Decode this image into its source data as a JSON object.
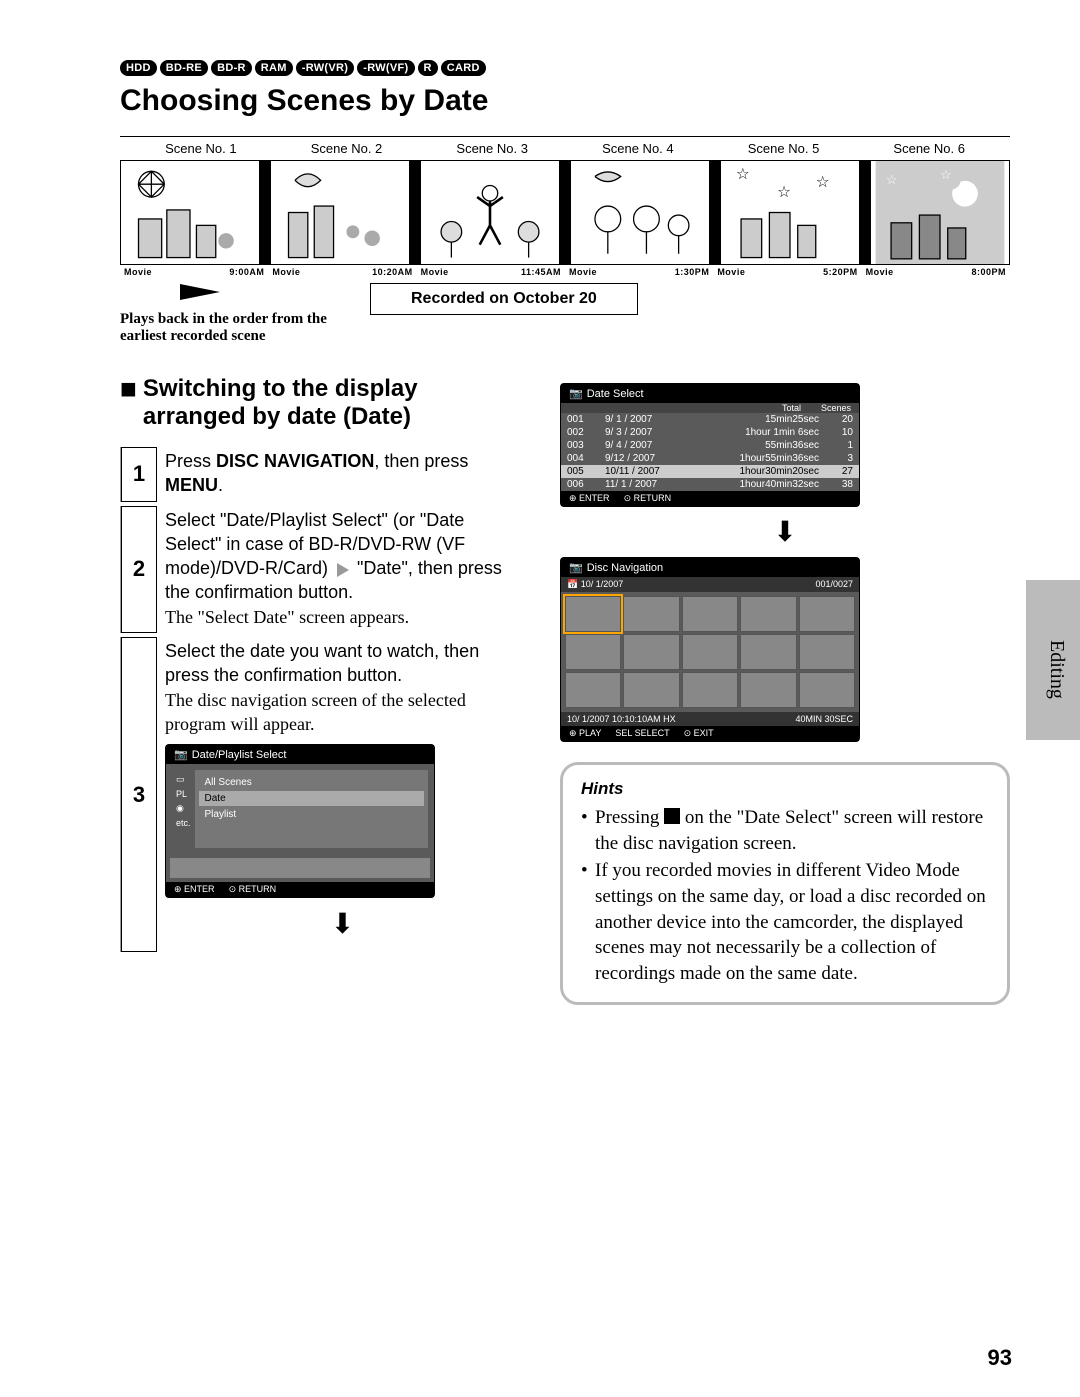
{
  "badges": [
    "HDD",
    "BD-RE",
    "BD-R",
    "RAM",
    "-RW(VR)",
    "-RW(VF)",
    "R",
    "CARD"
  ],
  "title": "Choosing Scenes by Date",
  "scene_headers": [
    "Scene No. 1",
    "Scene No. 2",
    "Scene No. 3",
    "Scene No. 4",
    "Scene No. 5",
    "Scene No. 6"
  ],
  "timerow": [
    {
      "lbl": "Movie",
      "t": "9:00AM"
    },
    {
      "lbl": "Movie",
      "t": "10:20AM"
    },
    {
      "lbl": "Movie",
      "t": "11:45AM"
    },
    {
      "lbl": "Movie",
      "t": "1:30PM"
    },
    {
      "lbl": "Movie",
      "t": "5:20PM"
    },
    {
      "lbl": "Movie",
      "t": "8:00PM"
    }
  ],
  "recorded_on": "Recorded on October 20",
  "playback_note": "Plays back in the order from the earliest recorded scene",
  "section_heading": "Switching to the display arranged by date (Date)",
  "steps": {
    "s1": {
      "num": "1",
      "body_html": "Press <b>DISC NAVIGATION</b>, then press <b>MENU</b>."
    },
    "s2": {
      "num": "2",
      "body_html": "Select \"Date/Playlist Select\" (or \"Date Select\" in case of BD-R/DVD-RW (VF mode)/DVD-R/Card) <span class='arrow-sep'></span> \"Date\", then press the confirmation button.",
      "note": "The \"Select Date\" screen appears."
    },
    "s3": {
      "num": "3",
      "body_html": "Select the date you want to watch, then press the confirmation button.",
      "note": "The disc navigation screen of the selected program will appear."
    }
  },
  "screen1": {
    "title": "Date/Playlist Select",
    "side": [
      "",
      "PL",
      "",
      "etc."
    ],
    "items": [
      "All Scenes",
      "Date",
      "Playlist"
    ],
    "selected": "Date",
    "footer": [
      "ENTER",
      "RETURN"
    ]
  },
  "screen2": {
    "title": "Date Select",
    "hdr": [
      "Total",
      "Scenes"
    ],
    "rows": [
      {
        "n": "001",
        "d": "9/  1 / 2007",
        "t": "15min25sec",
        "s": "20"
      },
      {
        "n": "002",
        "d": "9/  3 / 2007",
        "t": "1hour 1min 6sec",
        "s": "10"
      },
      {
        "n": "003",
        "d": "9/  4 / 2007",
        "t": "55min36sec",
        "s": "1"
      },
      {
        "n": "004",
        "d": "9/12 / 2007",
        "t": "1hour55min36sec",
        "s": "3"
      },
      {
        "n": "005",
        "d": "10/11 / 2007",
        "t": "1hour30min20sec",
        "s": "27"
      },
      {
        "n": "006",
        "d": "11/  1 / 2007",
        "t": "1hour40min32sec",
        "s": "38"
      }
    ],
    "selected_idx": 4,
    "footer": [
      "ENTER",
      "RETURN"
    ]
  },
  "screen3": {
    "title": "Disc Navigation",
    "date": "10/  1/2007",
    "counter": "001/0027",
    "bar_left": "10/ 1/2007 10:10:10AM HX",
    "bar_right": "40MIN 30SEC",
    "footer": [
      "PLAY",
      "SELECT",
      "EXIT"
    ]
  },
  "side_tab": "Editing",
  "hints": {
    "title": "Hints",
    "items": [
      "Pressing ◼ on the \"Date Select\" screen will restore the disc navigation screen.",
      "If you recorded movies in different Video Mode settings on the same day, or load a disc recorded on another device into the camcorder, the displayed scenes may not necessarily be a collection of recordings made on the same date."
    ]
  },
  "page_number": "93"
}
